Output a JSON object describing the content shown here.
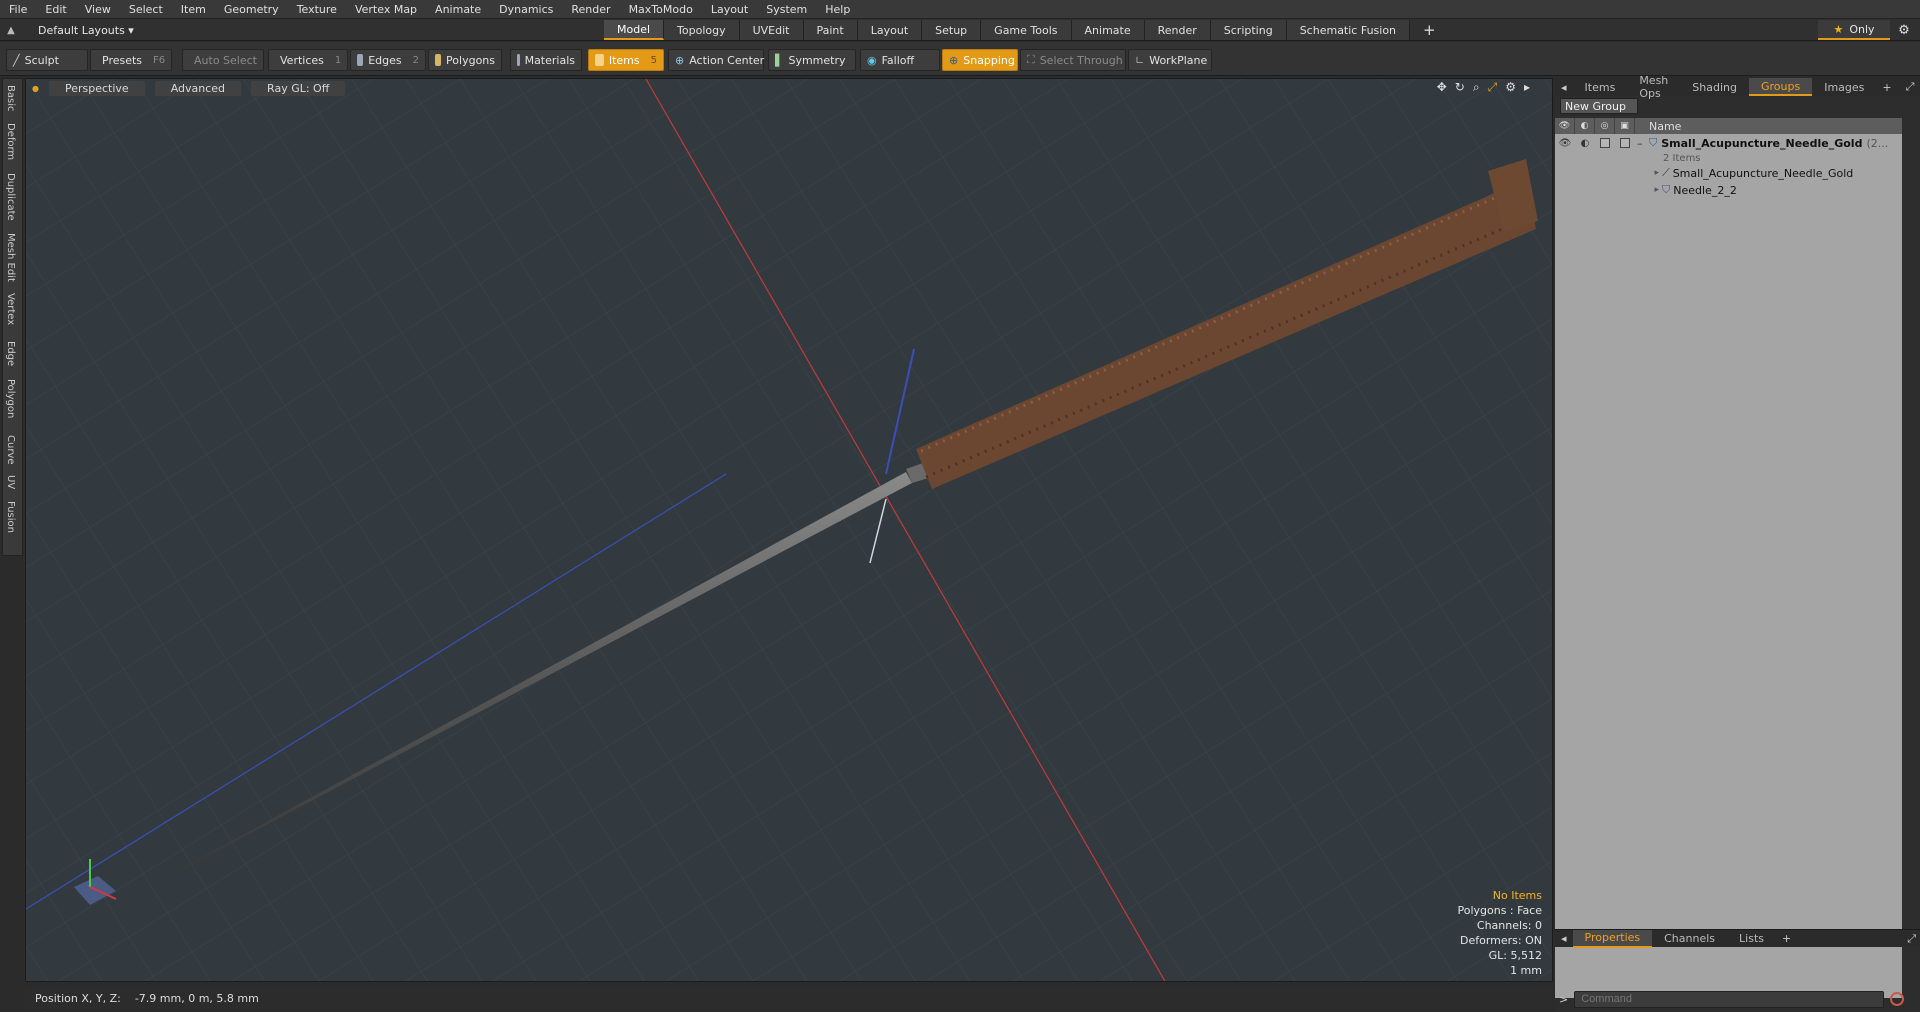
{
  "menubar": [
    "File",
    "Edit",
    "View",
    "Select",
    "Item",
    "Geometry",
    "Texture",
    "Vertex Map",
    "Animate",
    "Dynamics",
    "Render",
    "MaxToModo",
    "Layout",
    "System",
    "Help"
  ],
  "layouts": {
    "label": "Default Layouts ▾"
  },
  "modetabs": [
    {
      "label": "Model",
      "active": true
    },
    {
      "label": "Topology"
    },
    {
      "label": "UVEdit"
    },
    {
      "label": "Paint"
    },
    {
      "label": "Layout"
    },
    {
      "label": "Setup"
    },
    {
      "label": "Game Tools"
    },
    {
      "label": "Animate"
    },
    {
      "label": "Render"
    },
    {
      "label": "Scripting"
    },
    {
      "label": "Schematic Fusion"
    }
  ],
  "add_tab": "+",
  "only_button": {
    "star": "★",
    "label": "Only"
  },
  "toolbar": {
    "sculpt": "Sculpt",
    "presets": "Presets",
    "presets_key": "F6",
    "auto_select": "Auto Select",
    "vertices": "Vertices",
    "vertices_count": "1",
    "edges": "Edges",
    "edges_count": "2",
    "polygons": "Polygons",
    "materials": "Materials",
    "items": "Items",
    "items_count": "5",
    "action_center": "Action Center",
    "symmetry": "Symmetry",
    "falloff": "Falloff",
    "snapping": "Snapping",
    "select_through": "Select Through",
    "workplane": "WorkPlane"
  },
  "left_tabs": [
    "Basic",
    "Deform",
    "Duplicate",
    "Mesh Edit",
    "Vertex",
    "Edge",
    "Polygon",
    "Curve",
    "UV",
    "Fusion"
  ],
  "viewport": {
    "view_mode": "Perspective",
    "shading": "Advanced",
    "raygl": "Ray GL: Off",
    "info": {
      "no_items": "No Items",
      "polygons": "Polygons : Face",
      "channels": "Channels: 0",
      "deformers": "Deformers: ON",
      "gl": "GL: 5,512",
      "unit": "1 mm"
    }
  },
  "status": {
    "label": "Position X, Y, Z:",
    "value": "-7.9 mm, 0 m, 5.8 mm"
  },
  "right_panel": {
    "tabs": [
      {
        "label": "Items"
      },
      {
        "label": "Mesh Ops"
      },
      {
        "label": "Shading"
      },
      {
        "label": "Groups",
        "active": true
      },
      {
        "label": "Images"
      }
    ],
    "new_group": "New Group",
    "column_name": "Name",
    "rows": [
      {
        "name": "Small_Acupuncture_Needle_Gold",
        "suffix": "(2...",
        "bold": true
      },
      {
        "name": "2 Items",
        "sub": true
      },
      {
        "name": "Small_Acupuncture_Needle_Gold"
      },
      {
        "name": "Needle_2_2"
      }
    ],
    "bottom_tabs": [
      {
        "label": "Properties",
        "active": true
      },
      {
        "label": "Channels"
      },
      {
        "label": "Lists"
      }
    ],
    "command_placeholder": "Command"
  }
}
